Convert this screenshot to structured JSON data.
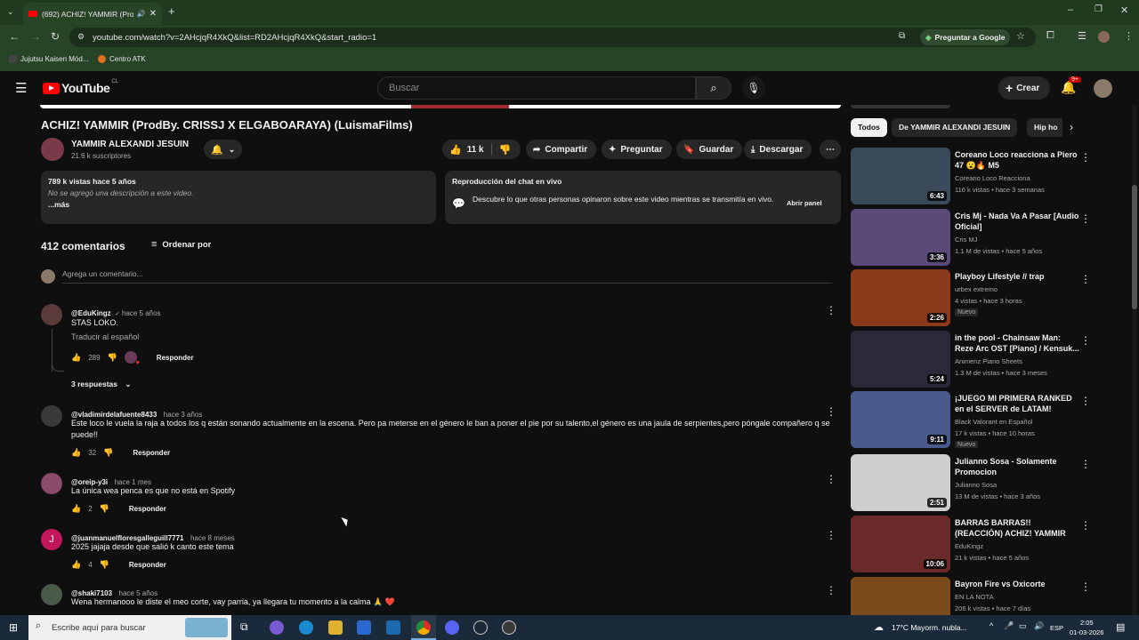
{
  "browser": {
    "tab_title": "(692) ACHIZ! YAMMIR (Prod",
    "url": "youtube.com/watch?v=2AHcjqR4XkQ&list=RD2AHcjqR4XkQ&start_radio=1",
    "ask_google": "Preguntar a Google",
    "bookmarks": [
      "Jujutsu Kaisen Mód...",
      "Centro ATK"
    ]
  },
  "header": {
    "logo_text": "YouTube",
    "country": "CL",
    "search_placeholder": "Buscar",
    "create_label": "Crear",
    "notif_count": "9+"
  },
  "video": {
    "title": "ACHIZ! YAMMIR (ProdBy. CRISSJ X ELGABOARAYA) (LuismaFilms)",
    "channel": "YAMMIR ALEXANDI JESUIN",
    "subscribers": "21.6 k suscriptores",
    "likes": "11 k",
    "share": "Compartir",
    "ask": "Preguntar",
    "save": "Guardar",
    "download": "Descargar"
  },
  "description": {
    "stats": "789 k vistas  hace 5 años",
    "text": "No se agregó una descripción a este video.",
    "more": "...más"
  },
  "chat": {
    "title": "Reproducción del chat en vivo",
    "text": "Descubre lo que otras personas opinaron sobre este video mientras se transmitía en vivo.",
    "button": "Abrir panel"
  },
  "comments": {
    "count": "412 comentarios",
    "sort": "Ordenar por",
    "add_placeholder": "Agrega un comentario...",
    "reply_label": "Responder",
    "items": [
      {
        "author": "@EduKingz",
        "time": "hace 5 años",
        "text": "STAS LOKO.",
        "translate": "Traducir al español",
        "likes": "289",
        "replies": "3 respuestas"
      },
      {
        "author": "@vladimirdelafuente8433",
        "time": "hace 3 años",
        "text": "Este loco le vuela la raja a todos los q están sonando actualmente en la escena. Pero pa meterse en el género le ban a poner el pie por su talento,el género es una jaula de serpientes,pero póngale compañero q se puede!!",
        "likes": "32"
      },
      {
        "author": "@oreip-y3i",
        "time": "hace 1 mes",
        "text": "La única wea penca es que no está en Spotify",
        "likes": "2"
      },
      {
        "author": "@juanmanuelfloresgalleguill7771",
        "time": "hace 8 meses",
        "text": "2025 jajaja desde que salió k canto este tema",
        "likes": "4",
        "avatar_letter": "J"
      },
      {
        "author": "@shaki7103",
        "time": "hace 5 años",
        "text": "Wena hermanooo le diste el meo corte, vay parria, ya llegara tu momento a la calma 🙏 ❤️"
      }
    ]
  },
  "sidebar": {
    "chips": [
      "Todos",
      "De YAMMIR ALEXANDI JESUIN",
      "Hip ho"
    ],
    "videos": [
      {
        "title": "Coreano Loco reacciona a Piero 47 😮🔥 M5",
        "channel": "Coreano Loco Reacciona",
        "meta": "116 k vistas • hace 3 semanas",
        "duration": "6:43",
        "color": "#3a4a5a"
      },
      {
        "title": "Cris Mj - Nada Va A Pasar [Audio Oficial]",
        "channel": "Cris MJ",
        "meta": "1.1 M de vistas • hace 5 años",
        "duration": "3:36",
        "color": "#5a4a7a"
      },
      {
        "title": "Playboy Lifestyle // trap",
        "channel": "urbex extremo",
        "meta": "4 vistas • hace 3 horas",
        "duration": "2:26",
        "badge": "Nuevo",
        "color": "#8a3a1a"
      },
      {
        "title": "in the pool - Chainsaw Man: Reze Arc OST [Piano] / Kensuk...",
        "channel": "Animenz Piano Sheets",
        "meta": "1.3 M de vistas • hace 3 meses",
        "duration": "5:24",
        "color": "#2a2a3a"
      },
      {
        "title": "¡JUEGO MI PRIMERA RANKED en el SERVER de LATAM!",
        "channel": "Black Valorant en Español",
        "meta": "17 k vistas • hace 10 horas",
        "duration": "9:11",
        "badge": "Nuevo",
        "color": "#4a5a8a"
      },
      {
        "title": "Julianno Sosa - Solamente Promocion",
        "channel": "Julianno Sosa",
        "meta": "13 M de vistas • hace 3 años",
        "duration": "2:51",
        "color": "#cfcfcf"
      },
      {
        "title": "BARRAS BARRAS!! (REACCIÓN) ACHIZ! YAMMIR",
        "channel": "EduKingz",
        "meta": "21 k vistas • hace 5 años",
        "duration": "10:06",
        "color": "#6a2a2a"
      },
      {
        "title": "Bayron Fire vs Oxicorte",
        "channel": "EN LA NOTA",
        "meta": "206 k vistas • hace 7 días",
        "duration": "",
        "color": "#7a4a1a"
      }
    ]
  },
  "taskbar": {
    "search_placeholder": "Escribe aquí para buscar",
    "weather": "17°C  Mayorm. nubla...",
    "lang": "ESP",
    "time": "2:05",
    "date": "01-03-2026"
  }
}
